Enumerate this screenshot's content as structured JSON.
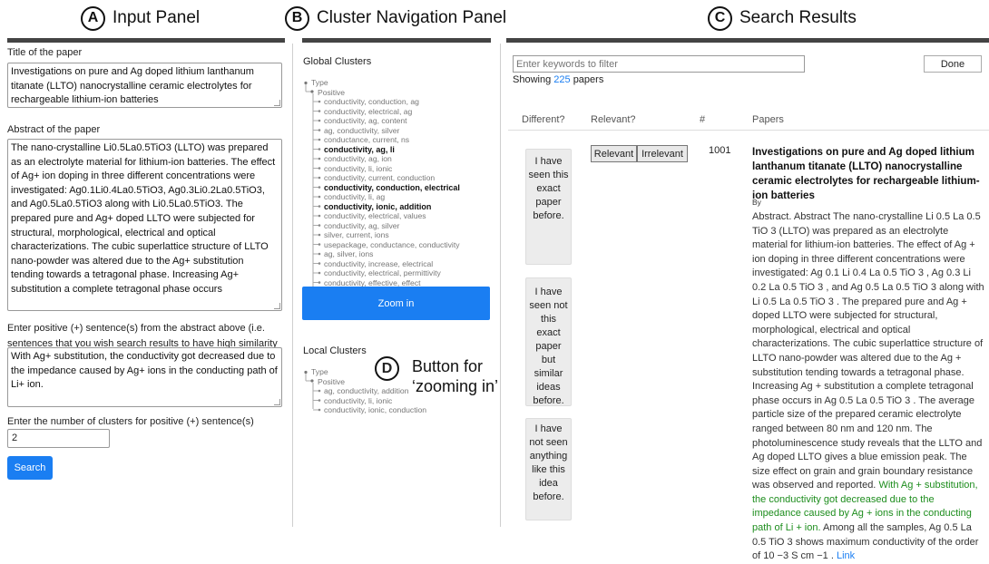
{
  "headers": {
    "a": {
      "letter": "A",
      "label": "Input Panel"
    },
    "b": {
      "letter": "B",
      "label": "Cluster Navigation Panel"
    },
    "c": {
      "letter": "C",
      "label": "Search Results"
    },
    "d": {
      "letter": "D",
      "label_line1": "Button for",
      "label_line2": "‘zooming in’"
    }
  },
  "input_panel": {
    "title_label": "Title of the paper",
    "title_value": "Investigations on pure and Ag doped lithium lanthanum titanate (LLTO) nanocrystalline ceramic electrolytes for rechargeable lithium-ion batteries",
    "abstract_label": "Abstract of the paper",
    "abstract_value": "The nano-crystalline Li0.5La0.5TiO3 (LLTO) was prepared as an electrolyte material for lithium-ion batteries. The effect of Ag+ ion doping in three different concentrations were investigated: Ag0.1Li0.4La0.5TiO3, Ag0.3Li0.2La0.5TiO3, and Ag0.5La0.5TiO3 along with Li0.5La0.5TiO3. The prepared pure and Ag+ doped LLTO were subjected for structural, morphological, electrical and optical characterizations. The cubic superlattice structure of LLTO nano-powder was altered due to the Ag+ substitution tending towards a tetragonal phase. Increasing Ag+ substitution a complete tetragonal phase occurs",
    "positive_label": "Enter positive (+) sentence(s) from the abstract above (i.e. sentences that you wish search results to have high similarity with)",
    "positive_value": "With Ag+ substitution, the conductivity got decreased due to the impedance caused by Ag+ ions in the conducting path of Li+ ion.",
    "clusters_label": "Enter the number of clusters for positive (+) sentence(s)",
    "clusters_value": "2",
    "search_label": "Search"
  },
  "cluster_panel": {
    "global_title": "Global Clusters",
    "root": "Type",
    "branch": "Positive",
    "global_items": [
      {
        "text": "conductivity, conduction, ag",
        "bold": false
      },
      {
        "text": "conductivity, electrical, ag",
        "bold": false
      },
      {
        "text": "conductivity, ag, content",
        "bold": false
      },
      {
        "text": "ag, conductivity, silver",
        "bold": false
      },
      {
        "text": "conductance, current, ns",
        "bold": false
      },
      {
        "text": "conductivity, ag, li",
        "bold": true
      },
      {
        "text": "conductivity, ag, ion",
        "bold": false
      },
      {
        "text": "conductivity, li, ionic",
        "bold": false
      },
      {
        "text": "conductivity, current, conduction",
        "bold": false
      },
      {
        "text": "conductivity, conduction, electrical",
        "bold": true
      },
      {
        "text": "conductivity, li, ag",
        "bold": false
      },
      {
        "text": "conductivity, ionic, addition",
        "bold": true
      },
      {
        "text": "conductivity, electrical, values",
        "bold": false
      },
      {
        "text": "conductivity, ag, silver",
        "bold": false
      },
      {
        "text": "silver, current, ions",
        "bold": false
      },
      {
        "text": "usepackage, conductance, conductivity",
        "bold": false
      },
      {
        "text": "ag, silver, ions",
        "bold": false
      },
      {
        "text": "conductivity, increase, electrical",
        "bold": false
      },
      {
        "text": "conductivity, electrical, permittivity",
        "bold": false
      },
      {
        "text": "conductivity, effective, effect",
        "bold": false
      }
    ],
    "zoom_label": "Zoom in",
    "local_title": "Local Clusters",
    "local_items": [
      {
        "text": "ag, conductivity, addition",
        "bold": false
      },
      {
        "text": "conductivity, li, ionic",
        "bold": false
      },
      {
        "text": "conductivity, ionic, conduction",
        "bold": false
      }
    ]
  },
  "results": {
    "filter_placeholder": "Enter keywords to filter",
    "done_label": "Done",
    "showing_prefix": "Showing",
    "showing_count": "225",
    "showing_suffix": "papers",
    "columns": {
      "different": "Different?",
      "relevant": "Relevant?",
      "num": "#",
      "papers": "Papers"
    },
    "diff_buttons": [
      "I have seen this exact paper before.",
      "I have seen not this exact paper but similar ideas before.",
      "I have not seen anything like this idea before."
    ],
    "relevant_label": "Relevant",
    "irrelevant_label": "Irrelevant",
    "row_number": "1001",
    "paper_title": "Investigations on pure and Ag doped lithium lanthanum titanate (LLTO) nanocrystalline ceramic electrolytes for rechargeable lithium-ion batteries",
    "paper_by": "By",
    "abstract_before": "Abstract. Abstract The nano-crystalline Li 0.5 La 0.5 TiO 3 (LLTO) was prepared as an electrolyte material for lithium-ion batteries. The effect of Ag + ion doping in three different concentrations were investigated: Ag 0.1 Li 0.4 La 0.5 TiO 3 , Ag 0.3 Li 0.2 La 0.5 TiO 3 , and Ag 0.5 La 0.5 TiO 3 along with Li 0.5 La 0.5 TiO 3 . The prepared pure and Ag + doped LLTO were subjected for structural, morphological, electrical and optical characterizations. The cubic superlattice structure of LLTO nano-powder was altered due to the Ag + substitution tending towards a tetragonal phase. Increasing Ag + substitution a complete tetragonal phase occurs in Ag 0.5 La 0.5 TiO 3 . The average particle size of the prepared ceramic electrolyte ranged between 80 nm and 120 nm. The photoluminescence study reveals that the LLTO and Ag doped LLTO gives a blue emission peak. The size effect on grain and grain boundary resistance was observed and reported.",
    "abstract_highlight": "With Ag + substitution, the conductivity got decreased due to the impedance caused by Ag + ions in the conducting path of Li + ion.",
    "abstract_after": "Among all the samples, Ag 0.5 La 0.5 TiO 3 shows maximum conductivity of the order of 10 −3 S cm −1 .",
    "link_label": "Link",
    "colors": {
      "accent": "#1a7ef2",
      "highlight": "#1d8d1d"
    }
  }
}
